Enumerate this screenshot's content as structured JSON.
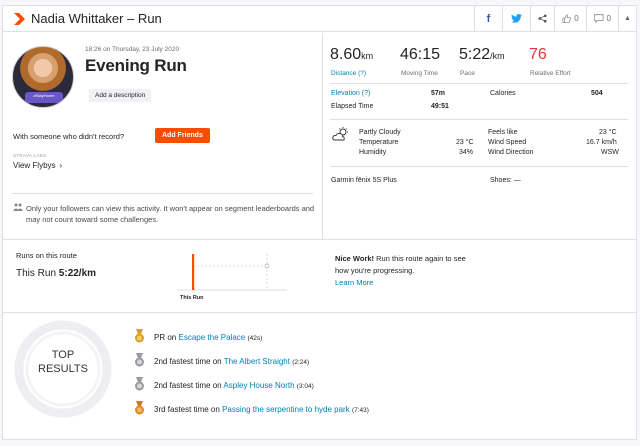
{
  "header": {
    "title": "Nadia Whittaker – Run",
    "kudos_count": "0",
    "comment_count": "0"
  },
  "activity": {
    "datetime": "18:26 on Thursday, 23 July 2020",
    "name": "Evening Run",
    "add_description": "Add a description",
    "avatar_badge": "#StayHome",
    "with_someone": "With someone who didn't record?",
    "add_friends": "Add Friends",
    "labs_label": "STRAVA LABS",
    "view_flybys": "View Flybys",
    "privacy_note": "Only your followers can view this activity. It won't appear on segment leaderboards and may not count toward some challenges."
  },
  "stats": {
    "distance_value": "8.60",
    "distance_unit": "km",
    "distance_label": "Distance (?)",
    "moving_time_value": "46:15",
    "moving_time_label": "Moving Time",
    "pace_value": "5:22",
    "pace_unit": "/km",
    "pace_label": "Pace",
    "effort_value": "76",
    "effort_label": "Relative Effort",
    "elevation_label": "Elevation (?)",
    "elevation_value": "57m",
    "calories_label": "Calories",
    "calories_value": "504",
    "elapsed_label": "Elapsed Time",
    "elapsed_value": "49:51"
  },
  "weather": {
    "condition": "Partly Cloudy",
    "temperature_label": "Temperature",
    "temperature_value": "23 °C",
    "humidity_label": "Humidity",
    "humidity_value": "34%",
    "feels_like_label": "Feels like",
    "feels_like_value": "23 °C",
    "wind_speed_label": "Wind Speed",
    "wind_speed_value": "16.7 km/h",
    "wind_direction_label": "Wind Direction",
    "wind_direction_value": "WSW"
  },
  "gear": {
    "device": "Garmin fēnix 5S Plus",
    "shoes_label": "Shoes: —"
  },
  "route": {
    "title": "Runs on this route",
    "this_run_label": "This Run",
    "this_run_pace": "5:22/km",
    "chart_label": "This Run",
    "nice_work": "Nice Work!",
    "message": "Run this route again to see how you're progressing.",
    "learn_more": "Learn More"
  },
  "top_results": {
    "title_line1": "TOP",
    "title_line2": "RESULTS",
    "items": [
      {
        "rank": "PR",
        "on": "on",
        "segment": "Escape the Palace",
        "time": "(42s)"
      },
      {
        "rank": "2nd fastest time",
        "on": "on",
        "segment": "The Albert Straight",
        "time": "(2:24)"
      },
      {
        "rank": "2nd fastest time",
        "on": "on",
        "segment": "Aspley House North",
        "time": "(3:04)"
      },
      {
        "rank": "3rd fastest time",
        "on": "on",
        "segment": "Passing the serpentine to hyde park",
        "time": "(7:43)"
      }
    ]
  },
  "colors": {
    "brand": "#fc4c02",
    "link": "#007fb6",
    "effort": "#e2343c",
    "gold": "#d6a12a",
    "silver": "#9a9aa0",
    "bronze": "#c97a2a"
  }
}
